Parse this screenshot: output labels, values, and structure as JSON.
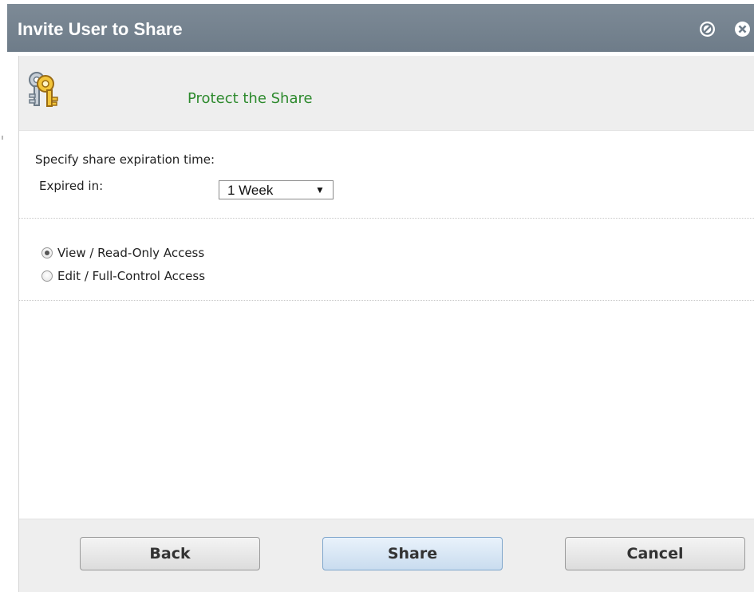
{
  "dialog": {
    "title": "Invite User to Share",
    "titlebar_buttons": [
      {
        "icon": "minimize-icon"
      },
      {
        "icon": "close-icon"
      }
    ]
  },
  "banner": {
    "icon": "keys-icon",
    "title": "Protect the Share",
    "title_color": "#2d8a2d"
  },
  "expiration": {
    "heading": "Specify share expiration time:",
    "label": "Expired in:",
    "selected": "1 Week",
    "arrow": "▼"
  },
  "access": {
    "options": [
      {
        "label": "View / Read-Only Access",
        "checked": true
      },
      {
        "label": "Edit / Full-Control Access",
        "checked": false
      }
    ]
  },
  "footer": {
    "back_label": "Back",
    "share_label": "Share",
    "cancel_label": "Cancel"
  }
}
